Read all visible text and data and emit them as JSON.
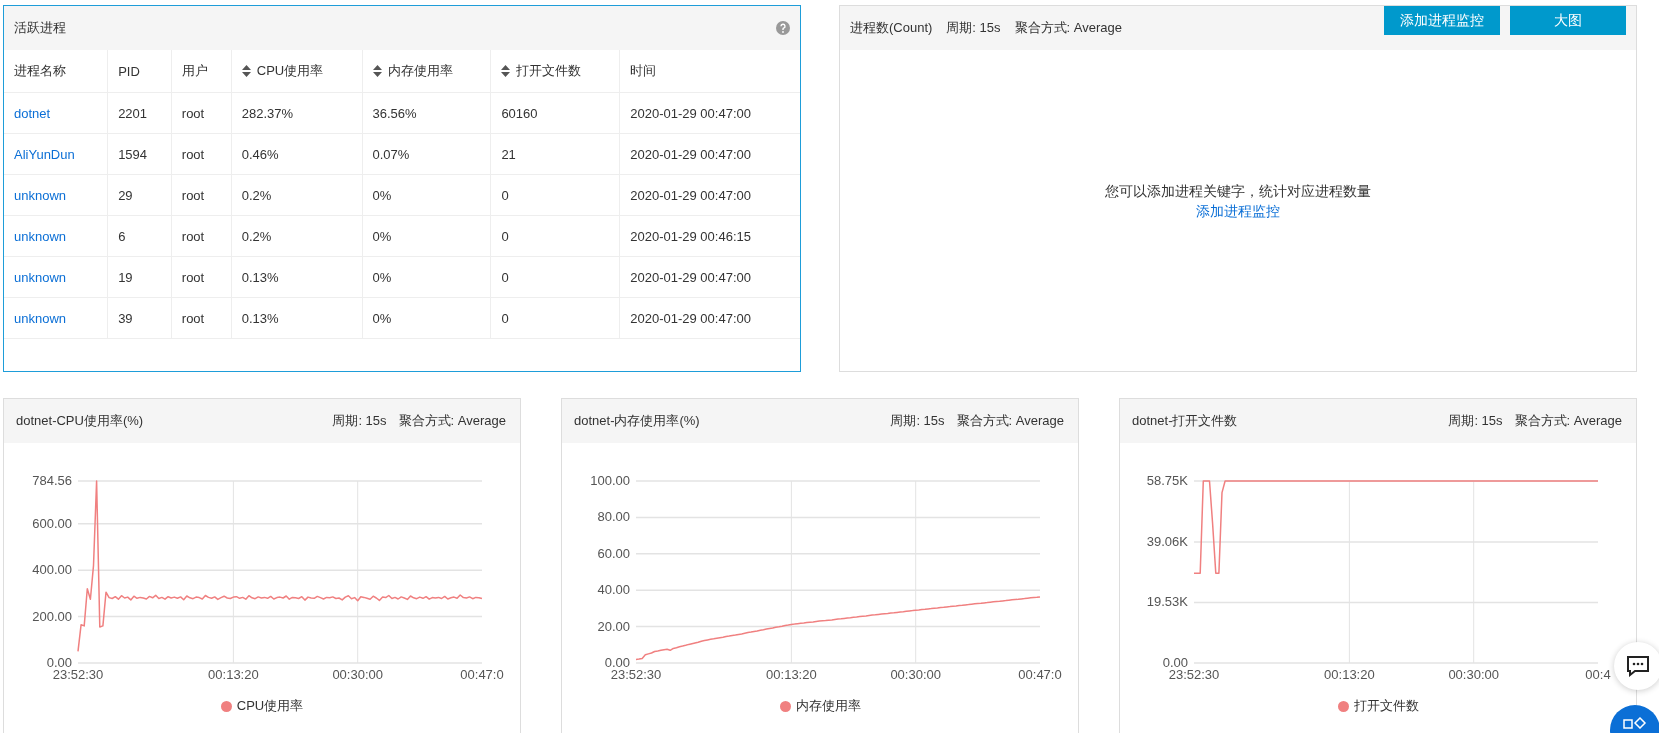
{
  "process_panel": {
    "title": "活跃进程",
    "columns": [
      {
        "label": "进程名称",
        "sortable": false
      },
      {
        "label": "PID",
        "sortable": false
      },
      {
        "label": "用户",
        "sortable": false
      },
      {
        "label": "CPU使用率",
        "sortable": true
      },
      {
        "label": "内存使用率",
        "sortable": true
      },
      {
        "label": "打开文件数",
        "sortable": true
      },
      {
        "label": "时间",
        "sortable": false
      }
    ],
    "rows": [
      [
        "dotnet",
        "2201",
        "root",
        "282.37%",
        "36.56%",
        "60160",
        "2020-01-29 00:47:00"
      ],
      [
        "AliYunDun",
        "1594",
        "root",
        "0.46%",
        "0.07%",
        "21",
        "2020-01-29 00:47:00"
      ],
      [
        "unknown",
        "29",
        "root",
        "0.2%",
        "0%",
        "0",
        "2020-01-29 00:47:00"
      ],
      [
        "unknown",
        "6",
        "root",
        "0.2%",
        "0%",
        "0",
        "2020-01-29 00:46:15"
      ],
      [
        "unknown",
        "19",
        "root",
        "0.13%",
        "0%",
        "0",
        "2020-01-29 00:47:00"
      ],
      [
        "unknown",
        "39",
        "root",
        "0.13%",
        "0%",
        "0",
        "2020-01-29 00:47:00"
      ]
    ]
  },
  "count_panel": {
    "title": "进程数(Count)",
    "period": "周期: 15s",
    "aggregation": "聚合方式: Average",
    "buttons": [
      "添加进程监控",
      "大图"
    ],
    "empty_message": "您可以添加进程关键字，统计对应进程数量",
    "empty_link": "添加进程监控"
  },
  "charts": [
    {
      "title": "dotnet-CPU使用率(%)",
      "period": "周期: 15s",
      "aggregation": "聚合方式: Average",
      "chart_data": {
        "type": "line",
        "grid": true,
        "ylim": [
          0,
          784.56
        ],
        "categories": [
          "23:52:30",
          null,
          null,
          null,
          null,
          null,
          null,
          null,
          null,
          null,
          null,
          null,
          null,
          null,
          null,
          null,
          null,
          null,
          null,
          null,
          null,
          null,
          null,
          null,
          null,
          null,
          null,
          null,
          null,
          null,
          null,
          null,
          null,
          null,
          null,
          null,
          null,
          null,
          null,
          null,
          null,
          null,
          null,
          null,
          null,
          null,
          null,
          null,
          null,
          null,
          "00:13:20",
          null,
          null,
          null,
          null,
          null,
          null,
          null,
          null,
          null,
          null,
          null,
          null,
          null,
          null,
          null,
          null,
          null,
          null,
          null,
          null,
          null,
          null,
          null,
          null,
          null,
          null,
          null,
          null,
          null,
          null,
          null,
          null,
          null,
          null,
          null,
          null,
          null,
          null,
          null,
          "00:30:00",
          null,
          null,
          null,
          null,
          null,
          null,
          null,
          null,
          null,
          null,
          null,
          null,
          null,
          null,
          null,
          null,
          null,
          null,
          null,
          null,
          null,
          null,
          null,
          null,
          null,
          null,
          null,
          null,
          null,
          null,
          null,
          null,
          null,
          null,
          null,
          null,
          null,
          null,
          null,
          "00:47:0"
        ],
        "yticks": [
          {
            "value": 0,
            "label": "0.00"
          },
          {
            "value": 200,
            "label": "200.00"
          },
          {
            "value": 400,
            "label": "400.00"
          },
          {
            "value": 600,
            "label": "600.00"
          },
          {
            "value": 784.56,
            "label": "784.56"
          }
        ],
        "series": [
          {
            "name": "CPU使用率",
            "color": "#f08080",
            "values": [
              50,
              165,
              160,
              320,
              275,
              420,
              784.56,
              155,
              160,
              305,
              282,
              278,
              286,
              275,
              290,
              280,
              284,
              272,
              288,
              279,
              283,
              280,
              276,
              287,
              281,
              292,
              278,
              283,
              275,
              286,
              280,
              284,
              279,
              285,
              273,
              289,
              281,
              277,
              284,
              282,
              276,
              291,
              283,
              279,
              285,
              274,
              282,
              288,
              280,
              278,
              284,
              286,
              279,
              283,
              275,
              290,
              281,
              277,
              285,
              280,
              283,
              279,
              287,
              276,
              282,
              284,
              280,
              289,
              275,
              283,
              281,
              278,
              286,
              271,
              284,
              280,
              279,
              287,
              282,
              276,
              283,
              281,
              285,
              278,
              280,
              272,
              284,
              290,
              277,
              282,
              268,
              286,
              283,
              279,
              275,
              288,
              280,
              270,
              284,
              282,
              291,
              278,
              283,
              276,
              285,
              280,
              274,
              289,
              281,
              277,
              284,
              279,
              286,
              275,
              282,
              280,
              283,
              278,
              287,
              276,
              281,
              284,
              279,
              293,
              282,
              280,
              285,
              277,
              283,
              281,
              278
            ]
          }
        ]
      }
    },
    {
      "title": "dotnet-内存使用率(%)",
      "period": "周期: 15s",
      "aggregation": "聚合方式: Average",
      "chart_data": {
        "type": "line",
        "grid": true,
        "ylim": [
          0,
          100
        ],
        "categories": [
          "23:52:30",
          null,
          null,
          null,
          null,
          null,
          null,
          null,
          null,
          null,
          null,
          null,
          null,
          null,
          null,
          null,
          null,
          null,
          null,
          null,
          null,
          null,
          null,
          null,
          null,
          null,
          null,
          null,
          null,
          null,
          null,
          null,
          null,
          null,
          null,
          null,
          null,
          null,
          null,
          null,
          null,
          null,
          null,
          null,
          null,
          null,
          null,
          null,
          null,
          null,
          "00:13:20",
          null,
          null,
          null,
          null,
          null,
          null,
          null,
          null,
          null,
          null,
          null,
          null,
          null,
          null,
          null,
          null,
          null,
          null,
          null,
          null,
          null,
          null,
          null,
          null,
          null,
          null,
          null,
          null,
          null,
          null,
          null,
          null,
          null,
          null,
          null,
          null,
          null,
          null,
          null,
          "00:30:00",
          null,
          null,
          null,
          null,
          null,
          null,
          null,
          null,
          null,
          null,
          null,
          null,
          null,
          null,
          null,
          null,
          null,
          null,
          null,
          null,
          null,
          null,
          null,
          null,
          null,
          null,
          null,
          null,
          null,
          null,
          null,
          null,
          null,
          null,
          null,
          null,
          null,
          null,
          null,
          "00:47:0"
        ],
        "yticks": [
          {
            "value": 0,
            "label": "0.00"
          },
          {
            "value": 20,
            "label": "20.00"
          },
          {
            "value": 40,
            "label": "40.00"
          },
          {
            "value": 60,
            "label": "60.00"
          },
          {
            "value": 80,
            "label": "80.00"
          },
          {
            "value": 100,
            "label": "100.00"
          }
        ],
        "series": [
          {
            "name": "内存使用率",
            "color": "#f08080",
            "values": [
              2.0,
              2.2,
              2.5,
              4.5,
              5.0,
              5.5,
              6.3,
              6.6,
              7.0,
              7.3,
              7.5,
              7.0,
              8.0,
              8.4,
              8.9,
              9.3,
              9.7,
              10.2,
              10.6,
              11.0,
              11.4,
              11.9,
              12.3,
              12.7,
              13.0,
              13.3,
              13.6,
              13.9,
              14.2,
              14.5,
              14.8,
              15.1,
              15.4,
              15.7,
              16.0,
              16.4,
              16.7,
              17.0,
              17.3,
              17.6,
              18.0,
              18.3,
              18.6,
              18.9,
              19.2,
              19.6,
              19.9,
              20.2,
              20.6,
              20.9,
              21.2,
              21.4,
              21.6,
              21.8,
              22.0,
              22.2,
              22.4,
              22.6,
              22.8,
              23.0,
              23.2,
              23.3,
              23.5,
              23.7,
              23.9,
              24.1,
              24.3,
              24.5,
              24.7,
              24.9,
              25.1,
              25.3,
              25.5,
              25.7,
              25.9,
              26.1,
              26.3,
              26.5,
              26.7,
              26.9,
              27.1,
              27.2,
              27.4,
              27.6,
              27.8,
              28.0,
              28.2,
              28.4,
              28.6,
              28.8,
              29.0,
              29.2,
              29.4,
              29.5,
              29.7,
              29.9,
              30.1,
              30.3,
              30.5,
              30.6,
              30.8,
              31.0,
              31.2,
              31.4,
              31.6,
              31.7,
              31.9,
              32.1,
              32.3,
              32.5,
              32.7,
              32.8,
              33.0,
              33.2,
              33.4,
              33.6,
              33.8,
              33.9,
              34.1,
              34.3,
              34.5,
              34.7,
              34.9,
              35.0,
              35.2,
              35.4,
              35.6,
              35.8,
              36.0,
              36.1,
              36.3
            ]
          }
        ]
      }
    },
    {
      "title": "dotnet-打开文件数",
      "period": "周期: 15s",
      "aggregation": "聚合方式: Average",
      "chart_data": {
        "type": "line",
        "grid": true,
        "ylim": [
          0,
          58750
        ],
        "categories": [
          "23:52:30",
          null,
          null,
          null,
          null,
          null,
          null,
          null,
          null,
          null,
          null,
          null,
          null,
          null,
          null,
          null,
          null,
          null,
          null,
          null,
          null,
          null,
          null,
          null,
          null,
          null,
          null,
          null,
          null,
          null,
          null,
          null,
          null,
          null,
          null,
          null,
          null,
          null,
          null,
          null,
          null,
          null,
          null,
          null,
          null,
          null,
          null,
          null,
          null,
          null,
          "00:13:20",
          null,
          null,
          null,
          null,
          null,
          null,
          null,
          null,
          null,
          null,
          null,
          null,
          null,
          null,
          null,
          null,
          null,
          null,
          null,
          null,
          null,
          null,
          null,
          null,
          null,
          null,
          null,
          null,
          null,
          null,
          null,
          null,
          null,
          null,
          null,
          null,
          null,
          null,
          null,
          "00:30:00",
          null,
          null,
          null,
          null,
          null,
          null,
          null,
          null,
          null,
          null,
          null,
          null,
          null,
          null,
          null,
          null,
          null,
          null,
          null,
          null,
          null,
          null,
          null,
          null,
          null,
          null,
          null,
          null,
          null,
          null,
          null,
          null,
          null,
          null,
          null,
          null,
          null,
          null,
          null,
          "00:4"
        ],
        "yticks": [
          {
            "value": 0,
            "label": "0.00"
          },
          {
            "value": 19530,
            "label": "19.53K"
          },
          {
            "value": 39060,
            "label": "39.06K"
          },
          {
            "value": 58750,
            "label": "58.75K"
          }
        ],
        "series": [
          {
            "name": "打开文件数",
            "color": "#f08080",
            "values": [
              29000,
              29000,
              29000,
              58750,
              58750,
              58750,
              45000,
              29000,
              29000,
              55000,
              58750,
              58750,
              58750,
              58750,
              58750,
              58750,
              58750,
              58750,
              58750,
              58750,
              58750,
              58750,
              58750,
              58750,
              58750,
              58750,
              58750,
              58750,
              58750,
              58750,
              58750,
              58750,
              58750,
              58750,
              58750,
              58750,
              58750,
              58750,
              58750,
              58750,
              58750,
              58750,
              58750,
              58750,
              58750,
              58750,
              58750,
              58750,
              58750,
              58750,
              58750,
              58750,
              58750,
              58750,
              58750,
              58750,
              58750,
              58750,
              58750,
              58750,
              58750,
              58750,
              58750,
              58750,
              58750,
              58750,
              58750,
              58750,
              58750,
              58750,
              58750,
              58750,
              58750,
              58750,
              58750,
              58750,
              58750,
              58750,
              58750,
              58750,
              58750,
              58750,
              58750,
              58750,
              58750,
              58750,
              58750,
              58750,
              58750,
              58750,
              58750,
              58750,
              58750,
              58750,
              58750,
              58750,
              58750,
              58750,
              58750,
              58750,
              58750,
              58750,
              58750,
              58750,
              58750,
              58750,
              58750,
              58750,
              58750,
              58750,
              58750,
              58750,
              58750,
              58750,
              58750,
              58750,
              58750,
              58750,
              58750,
              58750,
              58750,
              58750,
              58750,
              58750,
              58750,
              58750,
              58750,
              58750,
              58750,
              58750,
              58750
            ]
          }
        ]
      }
    }
  ]
}
